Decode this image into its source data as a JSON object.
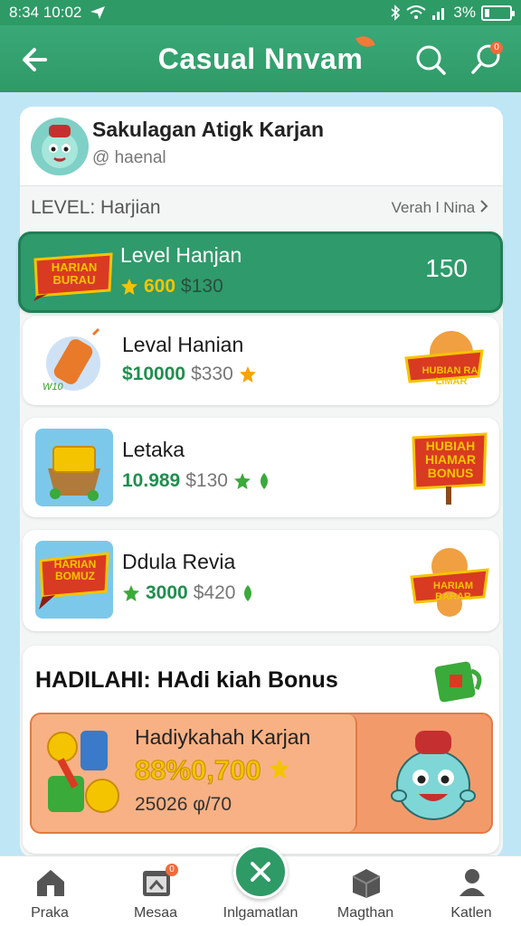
{
  "status_bar": {
    "time": "8:34 10:02",
    "battery": "3%",
    "battery_level": 0.2
  },
  "app_bar": {
    "title": "Casual Nnvam",
    "notification_count": "0"
  },
  "profile": {
    "name": "Sakulagan Atigk Karjan",
    "handle": "@ haenal"
  },
  "level_section": {
    "label": "LEVEL: Harjian",
    "view_link": "Verah l Nina"
  },
  "cards": [
    {
      "title": "Level Hanjan",
      "primary": "600",
      "secondary": "$130",
      "right_value": "150",
      "badge": "HARIAN BURAU"
    },
    {
      "title": "Leval Hanian",
      "primary": "$10000",
      "secondary": "$330",
      "badge": "HUBIAN RAI LIMAR",
      "art_label": "W10"
    },
    {
      "title": "Letaka",
      "primary": "10.989",
      "secondary": "$130",
      "badge": "HUBIAH HIAMAR BONUS"
    },
    {
      "title": "Ddula Revia",
      "primary": "3000",
      "secondary": "$420",
      "badge": "HARIAN BOMUZ",
      "right_badge": "HARIAM BARAR"
    }
  ],
  "bonus": {
    "heading": "HADILAHI: HAdi kiah Bonus",
    "card_title": "Hadiykahah Karjan",
    "amount": "88%0,700",
    "sub": "25026 φ/70"
  },
  "bottom_nav": [
    {
      "label": "Praka",
      "icon": "home-icon"
    },
    {
      "label": "Mesaa",
      "icon": "calendar-icon",
      "badge": "0"
    },
    {
      "label": "Inlgamatlan",
      "icon": "close-icon"
    },
    {
      "label": "Magthan",
      "icon": "box-icon"
    },
    {
      "label": "Katlen",
      "icon": "profile-icon"
    }
  ],
  "colors": {
    "primary": "#2e9a66",
    "accent": "#f07a3a",
    "gold": "#f5c400",
    "background": "#bfe6f5"
  }
}
